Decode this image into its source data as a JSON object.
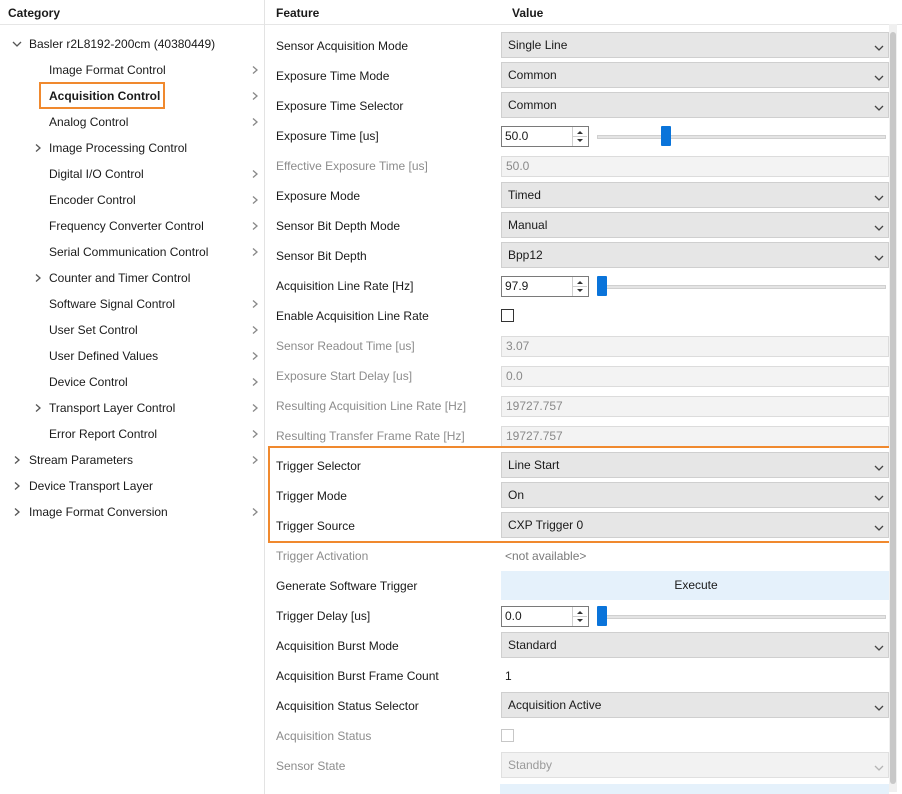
{
  "headers": {
    "category": "Category",
    "feature": "Feature",
    "value": "Value"
  },
  "tree": {
    "device": "Basler r2L8192-200cm (40380449)",
    "categories": [
      {
        "label": "Image Format Control",
        "expandable": false,
        "sub": true
      },
      {
        "label": "Acquisition Control",
        "expandable": false,
        "sub": true,
        "selected": true
      },
      {
        "label": "Analog Control",
        "expandable": false,
        "sub": true
      },
      {
        "label": "Image Processing Control",
        "expandable": true,
        "sub": false
      },
      {
        "label": "Digital I/O Control",
        "expandable": false,
        "sub": true
      },
      {
        "label": "Encoder Control",
        "expandable": false,
        "sub": true
      },
      {
        "label": "Frequency Converter Control",
        "expandable": false,
        "sub": true
      },
      {
        "label": "Serial Communication Control",
        "expandable": false,
        "sub": true
      },
      {
        "label": "Counter and Timer Control",
        "expandable": true,
        "sub": false
      },
      {
        "label": "Software Signal Control",
        "expandable": false,
        "sub": true
      },
      {
        "label": "User Set Control",
        "expandable": false,
        "sub": true
      },
      {
        "label": "User Defined Values",
        "expandable": false,
        "sub": true
      },
      {
        "label": "Device Control",
        "expandable": false,
        "sub": true
      },
      {
        "label": "Transport Layer Control",
        "expandable": true,
        "sub": true
      },
      {
        "label": "Error Report Control",
        "expandable": false,
        "sub": true
      }
    ],
    "roots": [
      {
        "label": "Stream Parameters",
        "sub": true
      },
      {
        "label": "Device Transport Layer",
        "sub": false
      },
      {
        "label": "Image Format Conversion",
        "sub": true
      }
    ]
  },
  "features": [
    {
      "label": "Sensor Acquisition Mode",
      "type": "dropdown",
      "value": "Single Line"
    },
    {
      "label": "Exposure Time Mode",
      "type": "dropdown",
      "value": "Common"
    },
    {
      "label": "Exposure Time Selector",
      "type": "dropdown",
      "value": "Common"
    },
    {
      "label": "Exposure Time [us]",
      "type": "spin",
      "value": "50.0",
      "level": 0.22
    },
    {
      "label": "Effective Exposure Time [us]",
      "type": "readonly",
      "value": "50.0",
      "disabled": true
    },
    {
      "label": "Exposure Mode",
      "type": "dropdown",
      "value": "Timed"
    },
    {
      "label": "Sensor Bit Depth Mode",
      "type": "dropdown",
      "value": "Manual"
    },
    {
      "label": "Sensor Bit Depth",
      "type": "dropdown",
      "value": "Bpp12"
    },
    {
      "label": "Acquisition Line Rate [Hz]",
      "type": "spin",
      "value": "97.9",
      "level": 0.0
    },
    {
      "label": "Enable Acquisition Line Rate",
      "type": "checkbox"
    },
    {
      "label": "Sensor Readout Time [us]",
      "type": "readonly",
      "value": "3.07",
      "disabled": true
    },
    {
      "label": "Exposure Start Delay [us]",
      "type": "readonly",
      "value": "0.0",
      "disabled": true
    },
    {
      "label": "Resulting Acquisition Line Rate [Hz]",
      "type": "readonly",
      "value": "19727.757",
      "disabled": true
    },
    {
      "label": "Resulting Transfer Frame Rate [Hz]",
      "type": "readonly",
      "value": "19727.757",
      "disabled": true
    },
    {
      "label": "Trigger Selector",
      "type": "dropdown",
      "value": "Line Start"
    },
    {
      "label": "Trigger Mode",
      "type": "dropdown",
      "value": "On"
    },
    {
      "label": "Trigger Source",
      "type": "dropdown",
      "value": "CXP Trigger 0"
    },
    {
      "label": "Trigger Activation",
      "type": "plain",
      "value": "<not available>",
      "disabled": true
    },
    {
      "label": "Generate Software Trigger",
      "type": "button",
      "value": "Execute"
    },
    {
      "label": "Trigger Delay [us]",
      "type": "spin",
      "value": "0.0",
      "level": 0.0
    },
    {
      "label": "Acquisition Burst Mode",
      "type": "dropdown",
      "value": "Standard"
    },
    {
      "label": "Acquisition Burst Frame Count",
      "type": "plain",
      "value": "1"
    },
    {
      "label": "Acquisition Status Selector",
      "type": "dropdown",
      "value": "Acquisition Active"
    },
    {
      "label": "Acquisition Status",
      "type": "checkbox",
      "disabled": true
    },
    {
      "label": "Sensor State",
      "type": "dropdown",
      "value": "Standby",
      "disabled": true
    }
  ],
  "colors": {
    "highlight": "#f0892e",
    "slider": "#0a74da",
    "execute_bg": "#e5f1fb"
  },
  "icons": {
    "expand": "chevron-right-icon",
    "collapse": "chevron-down-icon",
    "dropdown": "chevron-down-icon",
    "submenu": "chevron-right-icon"
  }
}
